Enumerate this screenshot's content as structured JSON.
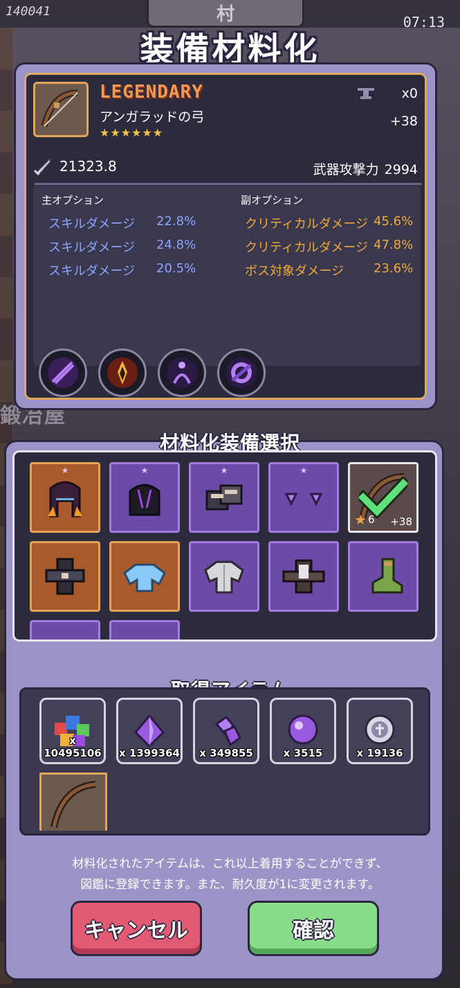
{
  "background": {
    "counter": "140041",
    "village_label": "村",
    "clock": "07:13",
    "shop_label": "鍛冶屋"
  },
  "title": "装備材料化",
  "item": {
    "rarity": "LEGENDARY",
    "name": "アンガラッドの弓",
    "stars": "★★★★★★",
    "anvil_count": "x0",
    "upgrade": "+38",
    "combat_power": "21323.8",
    "attack_label": "武器攻撃力",
    "attack_value": "2994",
    "main_options_label": "主オプション",
    "sub_options_label": "副オプション",
    "main_options": [
      {
        "name": "スキルダメージ",
        "value": "22.8%"
      },
      {
        "name": "スキルダメージ",
        "value": "24.8%"
      },
      {
        "name": "スキルダメージ",
        "value": "20.5%"
      }
    ],
    "sub_options": [
      {
        "name": "クリティカルダメージ",
        "value": "45.6%"
      },
      {
        "name": "クリティカルダメージ",
        "value": "47.8%"
      },
      {
        "name": "ボス対象ダメージ",
        "value": "23.6%"
      }
    ],
    "skill_icons": [
      "dark-slash-skill-icon",
      "fire-shield-skill-icon",
      "shadow-aura-skill-icon",
      "void-ring-skill-icon"
    ]
  },
  "selection": {
    "title": "材料化装備選択",
    "selected_level": "6",
    "selected_upgrade": "+38"
  },
  "gain": {
    "title": "取得アイテム",
    "items": [
      {
        "icon": "gem-pile-icon",
        "qty": "x 10495106"
      },
      {
        "icon": "purple-crystal-icon",
        "qty": "x 1399364"
      },
      {
        "icon": "purple-shard-icon",
        "qty": "x 349855"
      },
      {
        "icon": "purple-orb-icon",
        "qty": "x 3515"
      },
      {
        "icon": "silver-coin-icon",
        "qty": "x 19136"
      }
    ]
  },
  "notice": {
    "line1": "材料化されたアイテムは、これ以上着用することができず、",
    "line2": "図鑑に登録できます。また、耐久度が1に変更されます。"
  },
  "buttons": {
    "cancel": "キャンセル",
    "confirm": "確認"
  },
  "colors": {
    "legendary_orange": "#f29a55",
    "main_option_blue": "#8fa4ff",
    "sub_option_orange": "#f0a83c",
    "panel_lavender": "#9a95c6",
    "cancel_red": "#e35a73",
    "confirm_green": "#89dd8a"
  }
}
